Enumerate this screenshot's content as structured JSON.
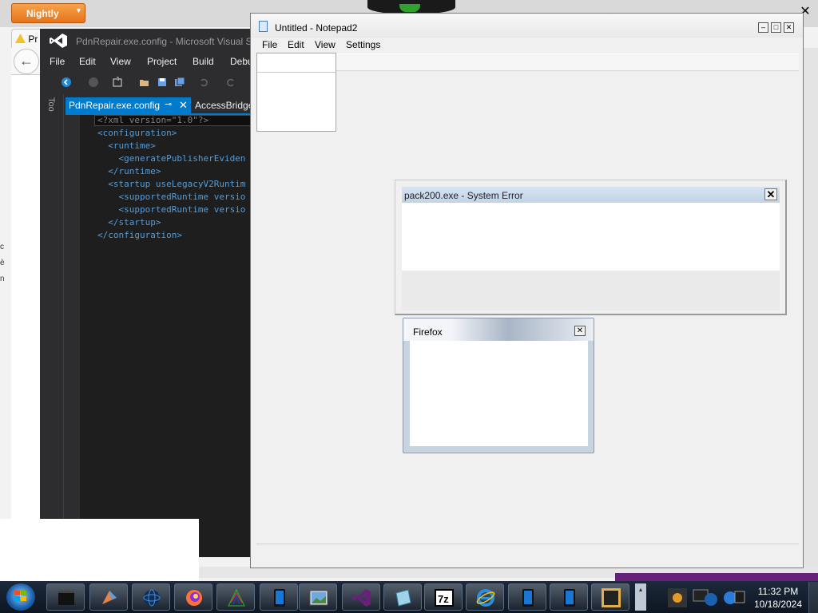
{
  "firefox": {
    "menu_button": "Nightly",
    "tab_label": "Pr",
    "left_edge_text": [
      "c",
      "è",
      "n"
    ]
  },
  "visual_studio": {
    "title": "PdnRepair.exe.config - Microsoft Visual S",
    "menu": [
      "File",
      "Edit",
      "View",
      "Project",
      "Build",
      "Debu"
    ],
    "side_panel_label": "Too",
    "active_tab": "PdnRepair.exe.config",
    "second_tab": "AccessBridge",
    "code_lines": [
      "<?xml version=\"1.0\"?>",
      "<configuration>",
      "  <runtime>",
      "    <generatePublisherEviden",
      "  </runtime>",
      "  <startup useLegacyV2Runtim",
      "    <supportedRuntime versio",
      "    <supportedRuntime versio",
      "  </startup>",
      "</configuration>"
    ]
  },
  "notepad": {
    "title": "Untitled - Notepad2",
    "menu": [
      "File",
      "Edit",
      "View",
      "Settings"
    ]
  },
  "error_dialog": {
    "title": "pack200.exe - System Error",
    "close_glyph": "✕"
  },
  "firefox_dialog": {
    "title": "Firefox",
    "close_glyph": "✕"
  },
  "taskbar": {
    "apps": [
      "terminal-icon",
      "paint-icon",
      "globe-icon",
      "firefox-icon",
      "graph-icon",
      "tablet-icon",
      "picture-viewer-icon",
      "visual-studio-icon",
      "notepad-icon",
      "7zip-icon",
      "internet-explorer-icon",
      "tablet-icon",
      "tablet-icon",
      "media-icon"
    ],
    "tray_overflow_glyph": "▴",
    "clock_time": "11:32 PM",
    "clock_date": "10/18/2024"
  },
  "colors": {
    "vs_accent": "#007acc",
    "vs_background": "#1e1e1e",
    "firefox_orange": "#e8731b",
    "taskbar": "#1c2a3c"
  }
}
